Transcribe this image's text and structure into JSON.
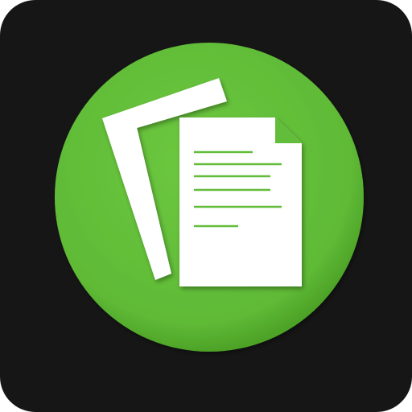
{
  "icon": {
    "name": "documents-app-icon",
    "glyph": "stacked-documents-icon",
    "colors": {
      "background": "#161616",
      "circle": "#62bd3a",
      "circle_shadow": "#3f8a22",
      "paper": "#ffffff",
      "text_lines": "#62bd3a"
    }
  }
}
